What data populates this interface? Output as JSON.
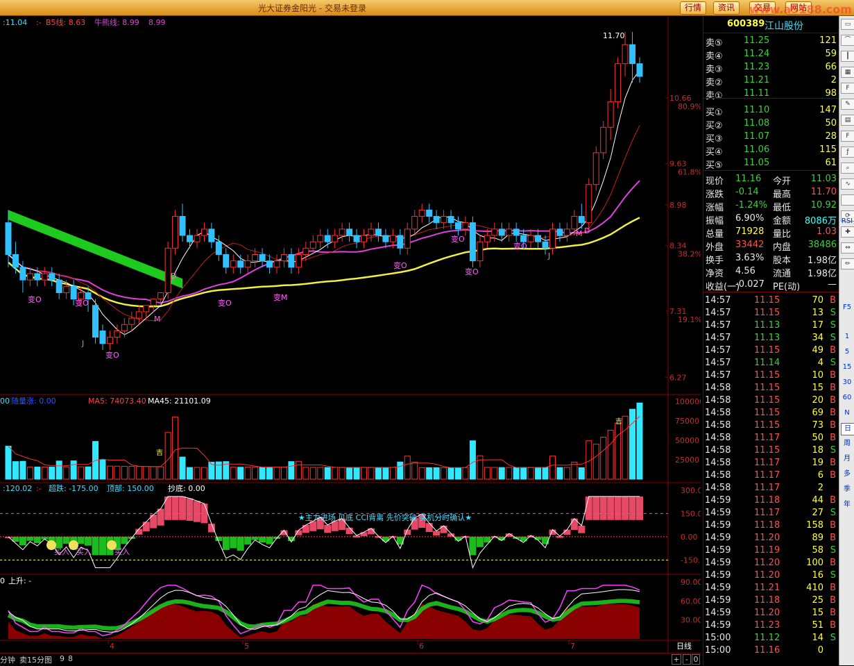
{
  "window": {
    "title": "光大证券金阳光 - 交易未登录",
    "buttons": [
      "行情",
      "资讯",
      "交易",
      "网站"
    ],
    "watermark": "www.a5188.com"
  },
  "stock": {
    "code": "600389",
    "name": "江山股份"
  },
  "price_panel": {
    "legend": [
      ":11.04",
      ":-",
      "B5线: 8.63",
      "牛熊线: 8.99",
      "8.99"
    ],
    "peak_label": "11.70",
    "y_ticks": [
      {
        "price": "10.66",
        "pct": "80.9%"
      },
      {
        "price": "9.63",
        "pct": "61.8%"
      },
      {
        "price": "8.98",
        "pct": ""
      },
      {
        "price": "8.34",
        "pct": "38.2%"
      },
      {
        "price": "7.31",
        "pct": "19.1%"
      },
      {
        "price": "6.27",
        "pct": ""
      }
    ],
    "markers": [
      "变O",
      "变O",
      "变O",
      "变O",
      "变M",
      "变O",
      "变O",
      "变O",
      "变O",
      "M",
      "D",
      "D",
      "J",
      "J",
      "J",
      "M"
    ]
  },
  "volume_panel": {
    "legend": [
      "00",
      "随量涨: 0.00",
      "MA5: 74073.40",
      "MA45: 21101.09"
    ],
    "y_ticks": [
      "100000",
      "75000",
      "50000",
      "25000"
    ],
    "labels": [
      "吉",
      "吉"
    ]
  },
  "cci_panel": {
    "legend": [
      ":120.02",
      ":-",
      "超跌: -175.00",
      "顶部: 150.00",
      "抄底: 0.00"
    ],
    "banner": "★主力进场 见底 CCI背离 先价突破 买机分时确认★",
    "y_ticks": [
      "300.0",
      "150.0",
      "0.00",
      "-150.0"
    ],
    "buy_labels": [
      "买入",
      "买入",
      "买入"
    ]
  },
  "kdj_panel": {
    "legend": [
      "0",
      "上升: -"
    ],
    "y_ticks": [
      "90.00",
      "60.00",
      "30.00"
    ]
  },
  "x_axis": {
    "labels": [
      "4",
      "5",
      "6",
      "7"
    ],
    "period_label": "日线"
  },
  "bottom_bar": {
    "items": [
      "分钟",
      "卖15分图",
      "9",
      "8"
    ],
    "controls": [
      "+",
      "-",
      "0"
    ]
  },
  "order_book": {
    "asks": [
      {
        "label": "卖⑤",
        "price": "11.25",
        "vol": "121"
      },
      {
        "label": "卖④",
        "price": "11.24",
        "vol": "59"
      },
      {
        "label": "卖③",
        "price": "11.23",
        "vol": "66"
      },
      {
        "label": "卖②",
        "price": "11.21",
        "vol": "2"
      },
      {
        "label": "卖①",
        "price": "11.11",
        "vol": "98"
      }
    ],
    "bids": [
      {
        "label": "买①",
        "price": "11.10",
        "vol": "147"
      },
      {
        "label": "买②",
        "price": "11.08",
        "vol": "50"
      },
      {
        "label": "买③",
        "price": "11.07",
        "vol": "28"
      },
      {
        "label": "买④",
        "price": "11.06",
        "vol": "115"
      },
      {
        "label": "买⑤",
        "price": "11.05",
        "vol": "61"
      }
    ]
  },
  "stats": [
    {
      "l1": "现价",
      "v1": "11.16",
      "c1": "dn",
      "l2": "今开",
      "v2": "11.03",
      "c2": "dn"
    },
    {
      "l1": "涨跌",
      "v1": "-0.14",
      "c1": "dn",
      "l2": "最高",
      "v2": "11.70",
      "c2": "up"
    },
    {
      "l1": "涨幅",
      "v1": "-1.24%",
      "c1": "dn",
      "l2": "最低",
      "v2": "10.92",
      "c2": "dn"
    },
    {
      "l1": "振幅",
      "v1": "6.90%",
      "c1": "wh",
      "l2": "金额",
      "v2": "8086万",
      "c2": "cy"
    },
    {
      "l1": "总量",
      "v1": "71928",
      "c1": "yl",
      "l2": "量比",
      "v2": "1.03",
      "c2": "up"
    },
    {
      "l1": "外盘",
      "v1": "33442",
      "c1": "up",
      "l2": "内盘",
      "v2": "38486",
      "c2": "dn"
    },
    {
      "l1": "换手",
      "v1": "3.63%",
      "c1": "wh",
      "l2": "股本",
      "v2": "1.98亿",
      "c2": "wh"
    },
    {
      "l1": "净资",
      "v1": "4.56",
      "c1": "wh",
      "l2": "流通",
      "v2": "1.98亿",
      "c2": "wh"
    },
    {
      "l1": "收益(一)",
      "v1": "-0.027",
      "c1": "wh",
      "l2": "PE(动)",
      "v2": "—",
      "c2": "wh"
    }
  ],
  "ticks": [
    {
      "t": "14:57",
      "p": "11.15",
      "v": "70",
      "s": "B"
    },
    {
      "t": "14:57",
      "p": "11.15",
      "v": "13",
      "s": "S"
    },
    {
      "t": "14:57",
      "p": "11.13",
      "v": "17",
      "s": "S"
    },
    {
      "t": "14:57",
      "p": "11.13",
      "v": "34",
      "s": "S"
    },
    {
      "t": "14:57",
      "p": "11.15",
      "v": "49",
      "s": "B"
    },
    {
      "t": "14:57",
      "p": "11.14",
      "v": "4",
      "s": "S"
    },
    {
      "t": "14:57",
      "p": "11.15",
      "v": "10",
      "s": "B"
    },
    {
      "t": "14:58",
      "p": "11.15",
      "v": "15",
      "s": "B"
    },
    {
      "t": "14:58",
      "p": "11.15",
      "v": "20",
      "s": "B"
    },
    {
      "t": "14:58",
      "p": "11.15",
      "v": "69",
      "s": "B"
    },
    {
      "t": "14:58",
      "p": "11.15",
      "v": "73",
      "s": "B"
    },
    {
      "t": "14:58",
      "p": "11.17",
      "v": "50",
      "s": "B"
    },
    {
      "t": "14:58",
      "p": "11.15",
      "v": "18",
      "s": "S"
    },
    {
      "t": "14:58",
      "p": "11.17",
      "v": "19",
      "s": "B"
    },
    {
      "t": "14:58",
      "p": "11.17",
      "v": "6",
      "s": "B"
    },
    {
      "t": "14:58",
      "p": "11.17",
      "v": "2",
      "s": ""
    },
    {
      "t": "14:59",
      "p": "11.18",
      "v": "44",
      "s": "B"
    },
    {
      "t": "14:59",
      "p": "11.17",
      "v": "27",
      "s": "S"
    },
    {
      "t": "14:59",
      "p": "11.18",
      "v": "158",
      "s": "B"
    },
    {
      "t": "14:59",
      "p": "11.20",
      "v": "89",
      "s": "B"
    },
    {
      "t": "14:59",
      "p": "11.19",
      "v": "58",
      "s": "S"
    },
    {
      "t": "14:59",
      "p": "11.20",
      "v": "100",
      "s": "B"
    },
    {
      "t": "14:59",
      "p": "11.20",
      "v": "16",
      "s": "S"
    },
    {
      "t": "14:59",
      "p": "11.21",
      "v": "410",
      "s": "B"
    },
    {
      "t": "14:59",
      "p": "11.18",
      "v": "25",
      "s": "B"
    },
    {
      "t": "14:59",
      "p": "11.20",
      "v": "15",
      "s": "B"
    },
    {
      "t": "14:59",
      "p": "11.23",
      "v": "51",
      "s": "B"
    },
    {
      "t": "15:00",
      "p": "11.12",
      "v": "14",
      "s": "S"
    },
    {
      "t": "15:00",
      "p": "11.16",
      "v": "0",
      "s": ""
    }
  ],
  "toolbar_icons": [
    "window-icon",
    "line-chart-icon",
    "candlestick-icon",
    "grid-icon",
    "f10-icon",
    "note-icon",
    "doc-icon",
    "f12-icon",
    "fx-icon",
    "search-icon",
    "wave-icon",
    "rsi-icon",
    "refresh-icon",
    "cross-icon",
    "move-icon",
    "pencil-icon"
  ],
  "toolbar_labels": [
    "RSI",
    "F5",
    "1",
    "5",
    "15",
    "30",
    "60",
    "N",
    "日",
    "周",
    "月",
    "多",
    "季",
    "年"
  ],
  "chart_data": {
    "type": "candlestick",
    "price_range": [
      6.27,
      11.7
    ],
    "candles": [
      [
        8.7,
        8.2,
        8.9,
        8.0
      ],
      [
        8.2,
        8.0,
        8.4,
        7.9
      ],
      [
        8.0,
        7.8,
        8.1,
        7.6
      ],
      [
        7.8,
        7.9,
        8.0,
        7.7
      ],
      [
        7.9,
        7.8,
        8.0,
        7.7
      ],
      [
        7.8,
        7.9,
        8.0,
        7.7
      ],
      [
        7.9,
        7.8,
        8.0,
        7.7
      ],
      [
        7.8,
        7.6,
        7.9,
        7.5
      ],
      [
        7.6,
        7.7,
        7.8,
        7.5
      ],
      [
        7.7,
        7.5,
        7.8,
        7.4
      ],
      [
        7.5,
        7.6,
        7.7,
        7.4
      ],
      [
        7.6,
        7.5,
        7.7,
        7.3
      ],
      [
        7.4,
        6.9,
        7.5,
        6.8
      ],
      [
        7.0,
        6.8,
        7.1,
        6.7
      ],
      [
        6.8,
        6.9,
        7.0,
        6.7
      ],
      [
        6.9,
        7.0,
        7.1,
        6.8
      ],
      [
        7.0,
        7.1,
        7.2,
        6.9
      ],
      [
        7.1,
        7.2,
        7.3,
        7.0
      ],
      [
        7.2,
        7.3,
        7.4,
        7.1
      ],
      [
        7.3,
        7.4,
        7.4,
        7.2
      ],
      [
        7.4,
        7.5,
        7.5,
        7.3
      ],
      [
        7.5,
        7.6,
        7.6,
        7.4
      ],
      [
        7.6,
        8.3,
        8.4,
        7.5
      ],
      [
        8.3,
        8.8,
        8.9,
        8.2
      ],
      [
        8.8,
        8.5,
        9.0,
        8.4
      ],
      [
        8.5,
        8.4,
        8.6,
        8.3
      ],
      [
        8.4,
        8.5,
        8.6,
        8.3
      ],
      [
        8.5,
        8.6,
        8.7,
        8.4
      ],
      [
        8.6,
        8.4,
        8.7,
        8.3
      ],
      [
        8.4,
        8.2,
        8.5,
        8.1
      ],
      [
        8.2,
        8.0,
        8.3,
        7.9
      ],
      [
        8.0,
        8.1,
        8.2,
        7.9
      ],
      [
        8.1,
        8.0,
        8.2,
        7.9
      ],
      [
        8.0,
        8.1,
        8.2,
        7.9
      ],
      [
        8.1,
        8.2,
        8.3,
        8.0
      ],
      [
        8.2,
        8.1,
        8.3,
        8.0
      ],
      [
        8.1,
        8.0,
        8.2,
        7.9
      ],
      [
        8.0,
        8.1,
        8.2,
        7.9
      ],
      [
        8.1,
        8.2,
        8.3,
        8.0
      ],
      [
        8.2,
        8.0,
        8.3,
        7.9
      ],
      [
        8.0,
        8.2,
        8.3,
        7.9
      ],
      [
        8.2,
        8.3,
        8.4,
        8.1
      ],
      [
        8.3,
        8.4,
        8.5,
        8.2
      ],
      [
        8.4,
        8.5,
        8.6,
        8.3
      ],
      [
        8.5,
        8.4,
        8.6,
        8.3
      ],
      [
        8.4,
        8.5,
        8.6,
        8.3
      ],
      [
        8.5,
        8.6,
        8.7,
        8.4
      ],
      [
        8.6,
        8.5,
        8.7,
        8.4
      ],
      [
        8.5,
        8.4,
        8.6,
        8.3
      ],
      [
        8.4,
        8.5,
        8.6,
        8.3
      ],
      [
        8.5,
        8.6,
        8.7,
        8.4
      ],
      [
        8.6,
        8.5,
        8.7,
        8.4
      ],
      [
        8.5,
        8.4,
        8.6,
        8.3
      ],
      [
        8.4,
        8.5,
        8.6,
        8.3
      ],
      [
        8.5,
        8.3,
        8.6,
        8.2
      ],
      [
        8.3,
        8.6,
        8.7,
        8.2
      ],
      [
        8.6,
        8.8,
        8.9,
        8.5
      ],
      [
        8.8,
        8.9,
        9.0,
        8.7
      ],
      [
        8.9,
        8.8,
        9.0,
        8.7
      ],
      [
        8.8,
        8.7,
        8.9,
        8.6
      ],
      [
        8.7,
        8.8,
        8.9,
        8.6
      ],
      [
        8.8,
        8.7,
        8.9,
        8.6
      ],
      [
        8.7,
        8.6,
        8.8,
        8.5
      ],
      [
        8.6,
        8.7,
        8.8,
        8.5
      ],
      [
        8.7,
        8.1,
        8.8,
        8.0
      ],
      [
        8.1,
        8.4,
        8.5,
        8.0
      ],
      [
        8.4,
        8.5,
        8.6,
        8.3
      ],
      [
        8.5,
        8.6,
        8.7,
        8.4
      ],
      [
        8.6,
        8.5,
        8.7,
        8.4
      ],
      [
        8.5,
        8.6,
        8.7,
        8.4
      ],
      [
        8.6,
        8.5,
        8.7,
        8.4
      ],
      [
        8.5,
        8.4,
        8.6,
        8.3
      ],
      [
        8.4,
        8.5,
        8.6,
        8.3
      ],
      [
        8.5,
        8.4,
        8.6,
        8.3
      ],
      [
        8.4,
        8.3,
        8.5,
        8.2
      ],
      [
        8.3,
        8.6,
        8.7,
        8.2
      ],
      [
        8.6,
        8.5,
        8.7,
        8.4
      ],
      [
        8.5,
        8.6,
        8.7,
        8.4
      ],
      [
        8.6,
        8.8,
        8.9,
        8.5
      ],
      [
        8.8,
        8.7,
        9.0,
        8.6
      ],
      [
        8.7,
        9.3,
        9.4,
        8.6
      ],
      [
        9.3,
        9.8,
        9.9,
        9.2
      ],
      [
        9.8,
        10.2,
        10.3,
        9.7
      ],
      [
        10.2,
        10.6,
        10.8,
        10.0
      ],
      [
        10.6,
        11.2,
        11.3,
        10.5
      ],
      [
        11.2,
        11.5,
        11.7,
        11.0
      ],
      [
        11.5,
        11.2,
        11.7,
        10.9
      ],
      [
        11.2,
        11.0,
        11.3,
        10.9
      ]
    ],
    "volume_ylim": [
      0,
      100000
    ]
  }
}
